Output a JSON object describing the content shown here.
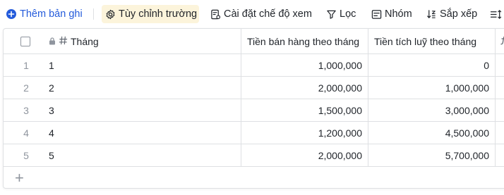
{
  "toolbar": {
    "add_record": "Thêm bản ghi",
    "customize_fields": "Tùy chỉnh trường",
    "view_settings": "Cài đặt chế độ xem",
    "filter": "Lọc",
    "group": "Nhóm",
    "sort": "Sắp xếp"
  },
  "colors": {
    "accent": "#245bdb",
    "active_button_bg": "#fcf4db",
    "border": "#dee0e3",
    "muted_text": "#8f959e"
  },
  "table": {
    "columns": {
      "month": "Tháng",
      "sales": "Tiền bán hàng theo tháng",
      "cumulative": "Tiền tích luỹ theo tháng"
    },
    "rows": [
      {
        "index": "1",
        "month": "1",
        "sales": "1,000,000",
        "cumulative": "0"
      },
      {
        "index": "2",
        "month": "2",
        "sales": "2,000,000",
        "cumulative": "1,000,000"
      },
      {
        "index": "3",
        "month": "3",
        "sales": "1,500,000",
        "cumulative": "3,000,000"
      },
      {
        "index": "4",
        "month": "4",
        "sales": "1,200,000",
        "cumulative": "4,500,000"
      },
      {
        "index": "5",
        "month": "5",
        "sales": "2,000,000",
        "cumulative": "5,700,000"
      }
    ],
    "add_row_symbol": "+"
  }
}
